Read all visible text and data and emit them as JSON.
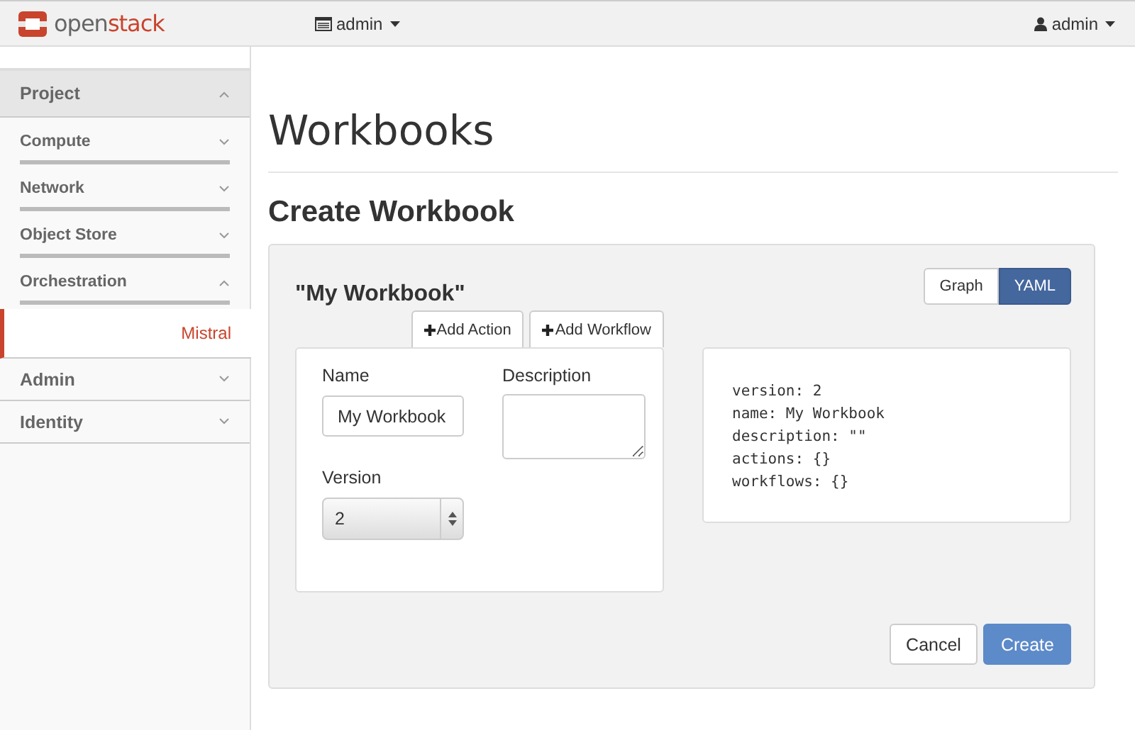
{
  "topbar": {
    "logo": {
      "prefix": "open",
      "suffix": "stack"
    },
    "project_menu": "admin",
    "user_menu": "admin"
  },
  "sidebar": {
    "panels": [
      {
        "label": "Project",
        "expanded": true,
        "children": [
          {
            "label": "Compute",
            "expanded": false
          },
          {
            "label": "Network",
            "expanded": false
          },
          {
            "label": "Object Store",
            "expanded": false
          },
          {
            "label": "Orchestration",
            "expanded": true,
            "children": [
              {
                "label": "Mistral",
                "selected": true
              }
            ]
          }
        ]
      },
      {
        "label": "Admin",
        "expanded": false
      },
      {
        "label": "Identity",
        "expanded": false
      }
    ]
  },
  "page_title": "Workbooks",
  "form": {
    "title": "Create Workbook",
    "workbook_name": "\"My Workbook\"",
    "view_toggle": [
      {
        "label": "Graph",
        "selected": false
      },
      {
        "label": "YAML",
        "selected": true
      }
    ],
    "add_buttons": [
      "Add Action",
      "Add Workflow"
    ],
    "fields": {
      "name": {
        "label": "Name",
        "value": "My Workbook"
      },
      "description": {
        "label": "Description"
      },
      "version": {
        "label": "Version",
        "value": "2"
      }
    },
    "yaml": [
      "version: 2",
      "name: My Workbook",
      "description: \"\"",
      "actions: {}",
      "workflows: {}"
    ],
    "buttons": [
      {
        "label": "Cancel",
        "kind": "default"
      },
      {
        "label": "Create",
        "kind": "primary"
      }
    ]
  }
}
